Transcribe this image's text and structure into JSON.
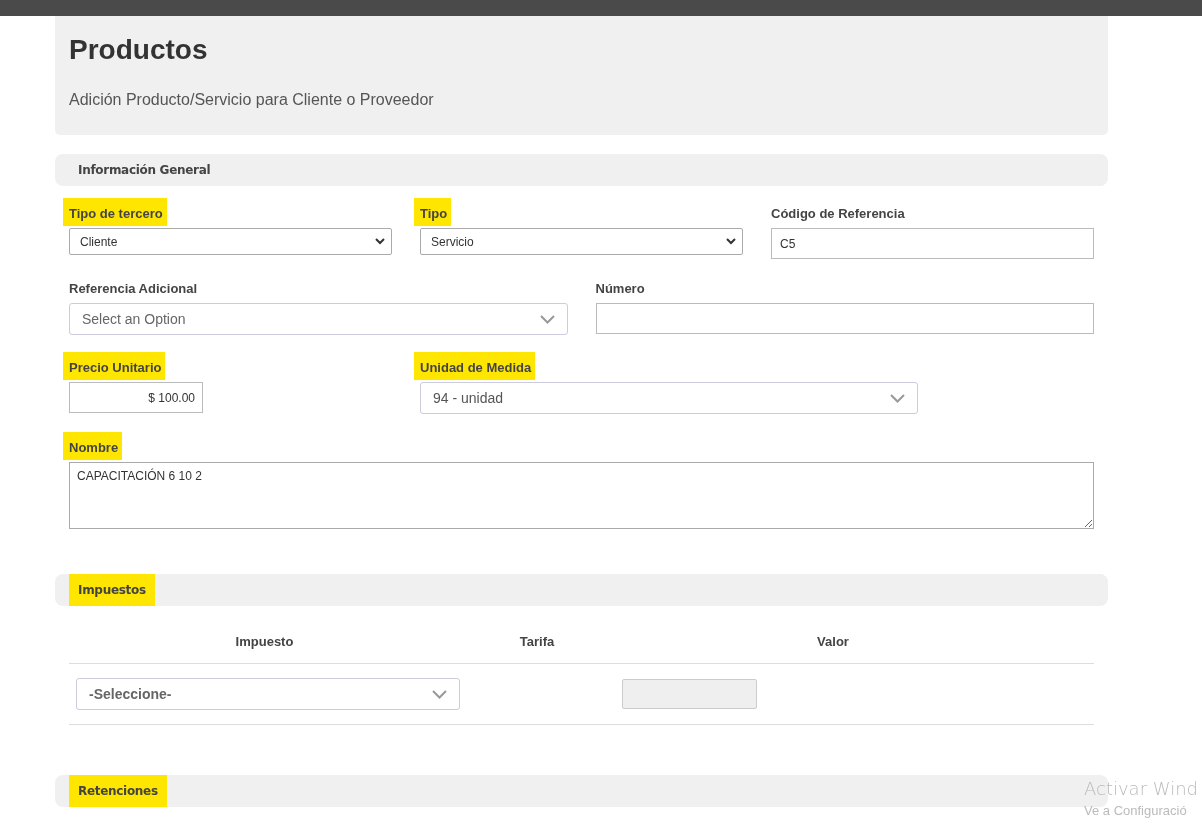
{
  "header": {
    "title": "Productos",
    "subtitle": "Adición Producto/Servicio para Cliente o Proveedor"
  },
  "general": {
    "title": "Información General",
    "highlighted": false,
    "rows": [
      {
        "fields": [
          {
            "label": "Tipo de tercero",
            "highlighted": true,
            "kind": "native-select",
            "value": "Cliente"
          },
          {
            "label": "Tipo",
            "highlighted": true,
            "kind": "native-select",
            "value": "Servicio"
          },
          {
            "label": "Código de Referencia",
            "highlighted": false,
            "kind": "text",
            "value": "C5"
          }
        ]
      },
      {
        "fields": [
          {
            "label": "Referencia Adicional",
            "highlighted": false,
            "kind": "custom-select",
            "placeholder": "Select an Option"
          },
          {
            "label": "Número",
            "highlighted": false,
            "kind": "text"
          }
        ]
      },
      {
        "fields": [
          {
            "label": "Precio Unitario",
            "highlighted": true,
            "kind": "money",
            "value": "$ 100.00"
          },
          {
            "label": "Unidad de Medida",
            "highlighted": true,
            "kind": "custom-select",
            "value": "94 - unidad"
          }
        ]
      },
      {
        "fields": [
          {
            "label": "Nombre",
            "highlighted": true,
            "kind": "textarea",
            "value": "CAPACITACIÓN 6 10 2"
          }
        ]
      }
    ]
  },
  "taxes": {
    "title": "Impuestos",
    "highlighted": true,
    "columns": [
      "Impuesto",
      "Tarifa",
      "Valor"
    ],
    "rows": [
      {
        "tax": {
          "placeholder": "-Seleccione-"
        },
        "value_disabled": true
      }
    ]
  },
  "withholdings": {
    "title": "Retenciones",
    "highlighted": true
  },
  "os_notice": {
    "line_1": "Activar Wind",
    "line_2": "Ve a Configuració"
  }
}
